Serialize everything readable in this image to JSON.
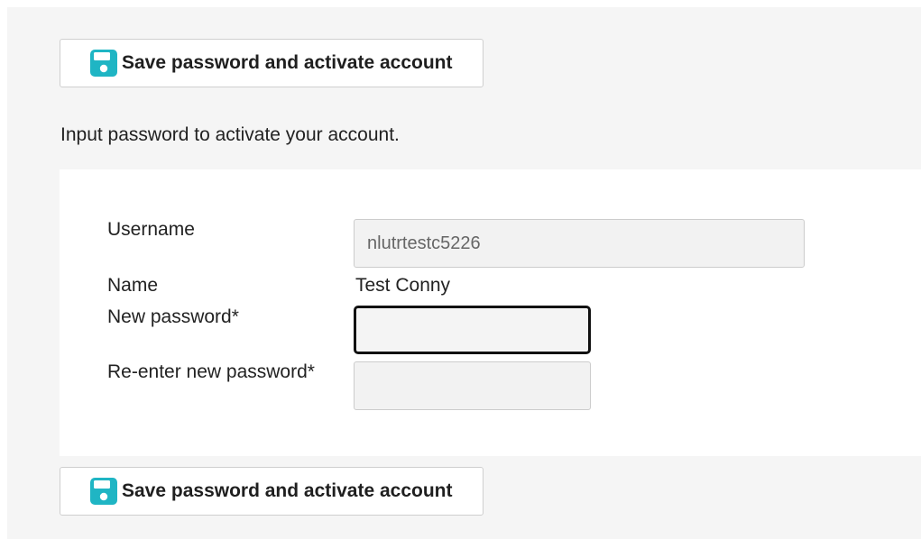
{
  "toolbar_top": {
    "save_label": "Save password and activate account",
    "icon": "save-icon"
  },
  "intro_text": "Input password to activate your account.",
  "form": {
    "username_label": "Username",
    "username_value": "nlutrtestc5226",
    "name_label": "Name",
    "name_value": "Test Conny",
    "new_password_label": "New password*",
    "new_password_value": "",
    "reenter_password_label": "Re-enter new password*",
    "reenter_password_value": ""
  },
  "toolbar_bottom": {
    "save_label": "Save password and activate account",
    "icon": "save-icon"
  },
  "colors": {
    "page_background": "#f5f5f5",
    "panel_background": "#ffffff",
    "save_icon": "#1fb5c4",
    "focus_border": "#111111"
  }
}
